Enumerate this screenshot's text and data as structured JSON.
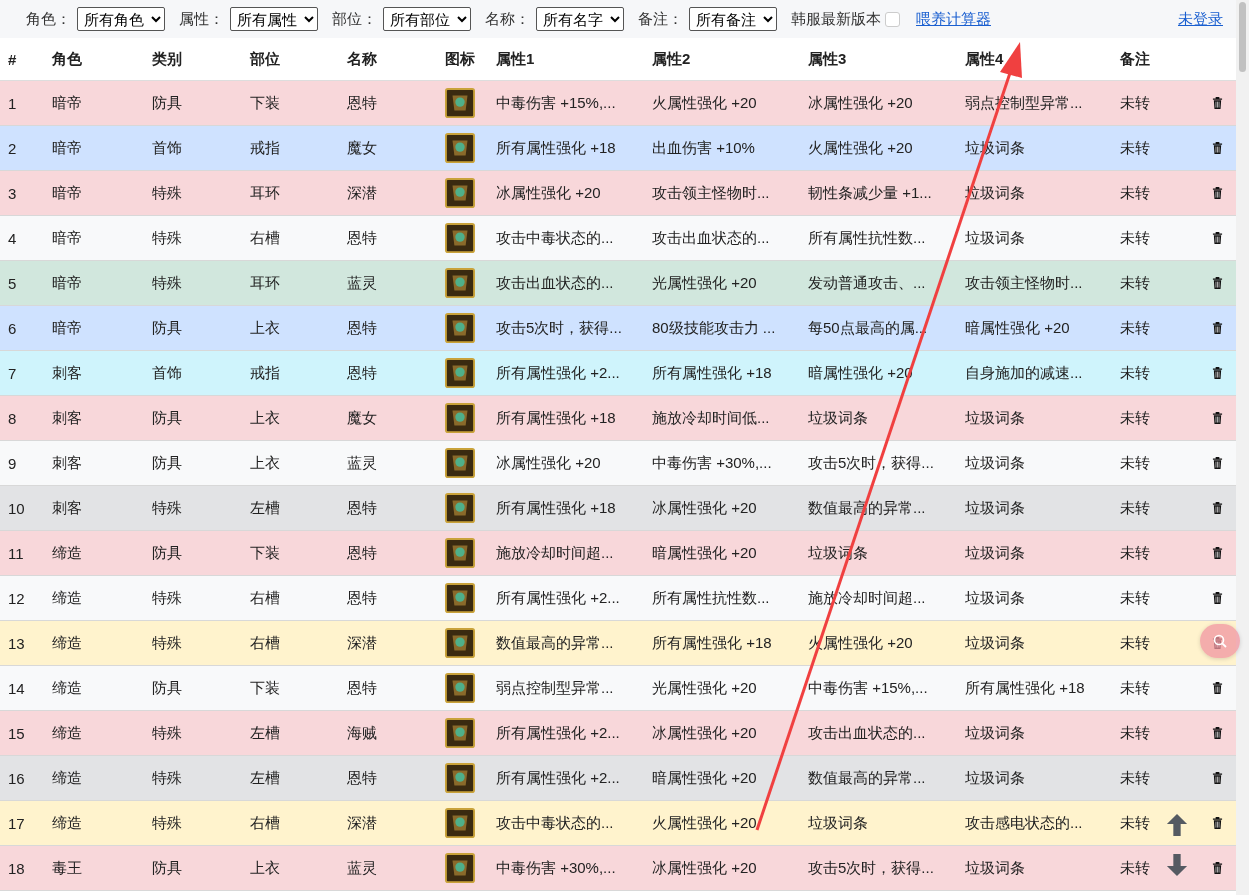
{
  "filters": [
    {
      "label": "角色：",
      "value": "所有角色"
    },
    {
      "label": "属性：",
      "value": "所有属性"
    },
    {
      "label": "部位：",
      "value": "所有部位"
    },
    {
      "label": "名称：",
      "value": "所有名字"
    },
    {
      "label": "备注：",
      "value": "所有备注"
    }
  ],
  "kr_toggle": {
    "label": "韩服最新版本",
    "checked": false
  },
  "calculator_link": "喂养计算器",
  "login_link": "未登录",
  "table": {
    "columns": [
      "#",
      "角色",
      "类别",
      "部位",
      "名称",
      "图标",
      "属性1",
      "属性2",
      "属性3",
      "属性4",
      "备注"
    ],
    "rows": [
      {
        "num": "1",
        "role": "暗帝",
        "category": "防具",
        "slot": "下装",
        "name": "恩特",
        "attrs": [
          "中毒伤害 +15%,...",
          "火属性强化 +20",
          "冰属性强化 +20",
          "弱点控制型异常..."
        ],
        "note": "未转",
        "color": "#f8d7da"
      },
      {
        "num": "2",
        "role": "暗帝",
        "category": "首饰",
        "slot": "戒指",
        "name": "魔女",
        "attrs": [
          "所有属性强化 +18",
          "出血伤害 +10%",
          "火属性强化 +20",
          "垃圾词条"
        ],
        "note": "未转",
        "color": "#cfe2ff"
      },
      {
        "num": "3",
        "role": "暗帝",
        "category": "特殊",
        "slot": "耳环",
        "name": "深潜",
        "attrs": [
          "冰属性强化 +20",
          "攻击领主怪物时...",
          "韧性条减少量 +1...",
          "垃圾词条"
        ],
        "note": "未转",
        "color": "#f8d7da"
      },
      {
        "num": "4",
        "role": "暗帝",
        "category": "特殊",
        "slot": "右槽",
        "name": "恩特",
        "attrs": [
          "攻击中毒状态的...",
          "攻击出血状态的...",
          "所有属性抗性数...",
          "垃圾词条"
        ],
        "note": "未转",
        "color": "#f8f9fa"
      },
      {
        "num": "5",
        "role": "暗帝",
        "category": "特殊",
        "slot": "耳环",
        "name": "蓝灵",
        "attrs": [
          "攻击出血状态的...",
          "光属性强化 +20",
          "发动普通攻击、...",
          "攻击领主怪物时..."
        ],
        "note": "未转",
        "color": "#d1e7dd"
      },
      {
        "num": "6",
        "role": "暗帝",
        "category": "防具",
        "slot": "上衣",
        "name": "恩特",
        "attrs": [
          "攻击5次时，获得...",
          "80级技能攻击力 ...",
          "每50点最高的属...",
          "暗属性强化 +20"
        ],
        "note": "未转",
        "color": "#cfe2ff"
      },
      {
        "num": "7",
        "role": "刺客",
        "category": "首饰",
        "slot": "戒指",
        "name": "恩特",
        "attrs": [
          "所有属性强化 +2...",
          "所有属性强化 +18",
          "暗属性强化 +20",
          "自身施加的减速..."
        ],
        "note": "未转",
        "color": "#cff4fc"
      },
      {
        "num": "8",
        "role": "刺客",
        "category": "防具",
        "slot": "上衣",
        "name": "魔女",
        "attrs": [
          "所有属性强化 +18",
          "施放冷却时间低...",
          "垃圾词条",
          "垃圾词条"
        ],
        "note": "未转",
        "color": "#f8d7da"
      },
      {
        "num": "9",
        "role": "刺客",
        "category": "防具",
        "slot": "上衣",
        "name": "蓝灵",
        "attrs": [
          "冰属性强化 +20",
          "中毒伤害 +30%,...",
          "攻击5次时，获得...",
          "垃圾词条"
        ],
        "note": "未转",
        "color": "#f8f9fa"
      },
      {
        "num": "10",
        "role": "刺客",
        "category": "特殊",
        "slot": "左槽",
        "name": "恩特",
        "attrs": [
          "所有属性强化 +18",
          "冰属性强化 +20",
          "数值最高的异常...",
          "垃圾词条"
        ],
        "note": "未转",
        "color": "#e2e3e5"
      },
      {
        "num": "11",
        "role": "缔造",
        "category": "防具",
        "slot": "下装",
        "name": "恩特",
        "attrs": [
          "施放冷却时间超...",
          "暗属性强化 +20",
          "垃圾词条",
          "垃圾词条"
        ],
        "note": "未转",
        "color": "#f8d7da"
      },
      {
        "num": "12",
        "role": "缔造",
        "category": "特殊",
        "slot": "右槽",
        "name": "恩特",
        "attrs": [
          "所有属性强化 +2...",
          "所有属性抗性数...",
          "施放冷却时间超...",
          "垃圾词条"
        ],
        "note": "未转",
        "color": "#f8f9fa"
      },
      {
        "num": "13",
        "role": "缔造",
        "category": "特殊",
        "slot": "右槽",
        "name": "深潜",
        "attrs": [
          "数值最高的异常...",
          "所有属性强化 +18",
          "火属性强化 +20",
          "垃圾词条"
        ],
        "note": "未转",
        "color": "#fff3cd"
      },
      {
        "num": "14",
        "role": "缔造",
        "category": "防具",
        "slot": "下装",
        "name": "恩特",
        "attrs": [
          "弱点控制型异常...",
          "光属性强化 +20",
          "中毒伤害 +15%,...",
          "所有属性强化 +18"
        ],
        "note": "未转",
        "color": "#f8f9fa"
      },
      {
        "num": "15",
        "role": "缔造",
        "category": "特殊",
        "slot": "左槽",
        "name": "海贼",
        "attrs": [
          "所有属性强化 +2...",
          "冰属性强化 +20",
          "攻击出血状态的...",
          "垃圾词条"
        ],
        "note": "未转",
        "color": "#f8d7da"
      },
      {
        "num": "16",
        "role": "缔造",
        "category": "特殊",
        "slot": "左槽",
        "name": "恩特",
        "attrs": [
          "所有属性强化 +2...",
          "暗属性强化 +20",
          "数值最高的异常...",
          "垃圾词条"
        ],
        "note": "未转",
        "color": "#e2e3e5"
      },
      {
        "num": "17",
        "role": "缔造",
        "category": "特殊",
        "slot": "右槽",
        "name": "深潜",
        "attrs": [
          "攻击中毒状态的...",
          "火属性强化 +20",
          "垃圾词条",
          "攻击感电状态的..."
        ],
        "note": "未转",
        "color": "#fff3cd"
      },
      {
        "num": "18",
        "role": "毒王",
        "category": "防具",
        "slot": "上衣",
        "name": "蓝灵",
        "attrs": [
          "中毒伤害 +30%,...",
          "冰属性强化 +20",
          "攻击5次时，获得...",
          "垃圾词条"
        ],
        "note": "未转",
        "color": "#f8d7da"
      }
    ]
  }
}
